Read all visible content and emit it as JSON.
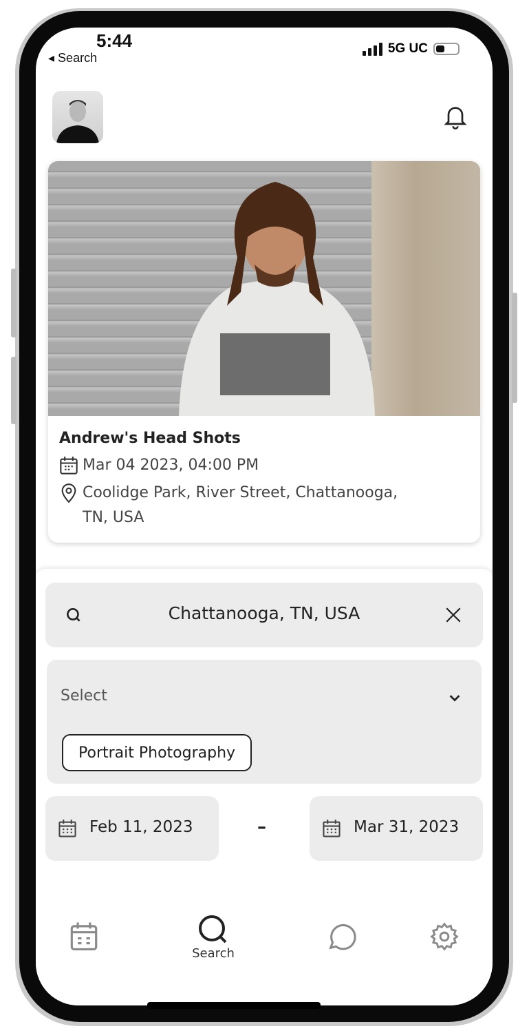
{
  "status_bar": {
    "time": "5:44",
    "back_label": "Search",
    "network": "5G UC"
  },
  "header": {
    "avatar": "profile-photo",
    "notification_icon": "bell-icon"
  },
  "event_card": {
    "title": "Andrew's Head Shots",
    "datetime": "Mar 04 2023, 04:00 PM",
    "location_line1": "Coolidge Park, River Street, Chattanooga,",
    "location_line2": "TN, USA"
  },
  "filters": {
    "search_value": "Chattanooga, TN, USA",
    "category_placeholder": "Select",
    "selected_chips": [
      "Portrait Photography"
    ],
    "start_date": "Feb 11, 2023",
    "date_separator": "–",
    "end_date": "Mar 31, 2023"
  },
  "bottom_nav": {
    "items": [
      {
        "icon": "calendar-icon",
        "label": ""
      },
      {
        "icon": "search-icon",
        "label": "Search",
        "active": true
      },
      {
        "icon": "chat-icon",
        "label": ""
      },
      {
        "icon": "gear-icon",
        "label": ""
      }
    ]
  },
  "colors": {
    "field_bg": "#ececec",
    "text": "#222222",
    "inactive_icon": "#8a8a8a"
  }
}
